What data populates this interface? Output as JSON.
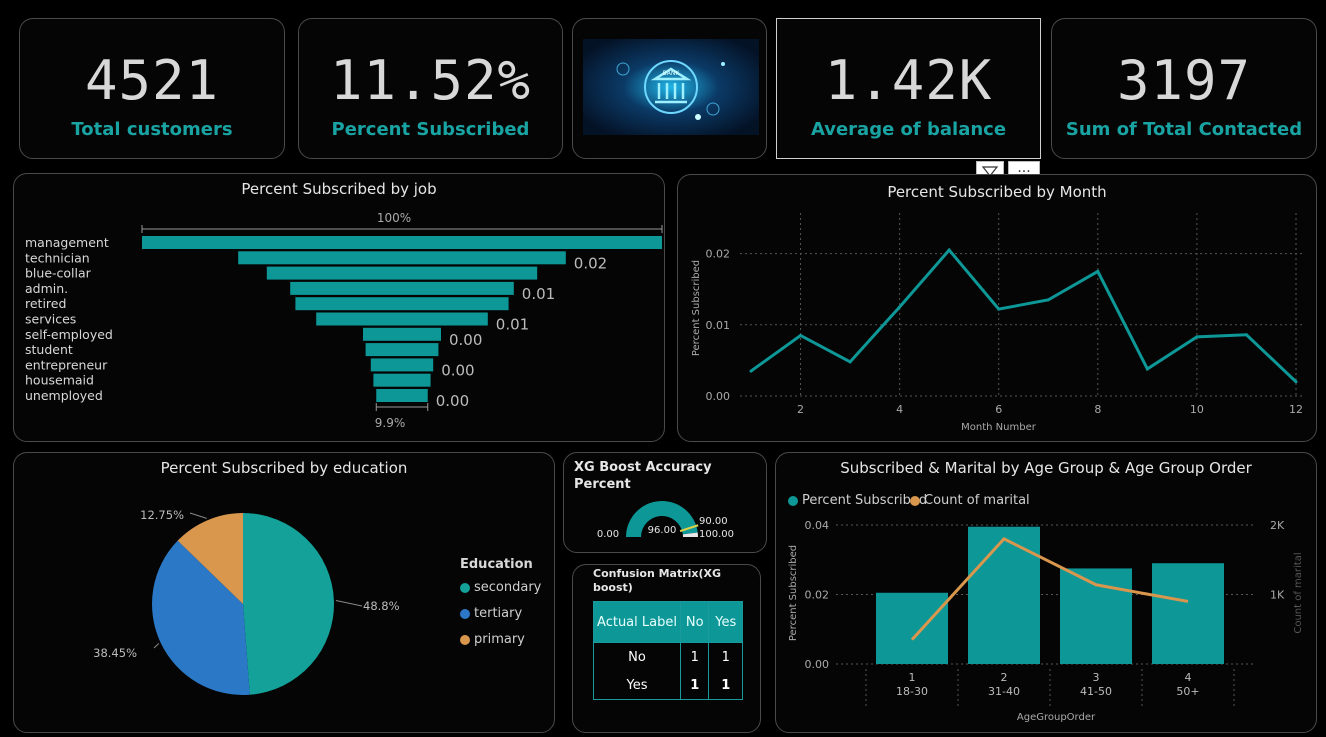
{
  "kpis": {
    "total_customers": {
      "value": "4521",
      "label": "Total customers"
    },
    "percent_subscribed": {
      "value": "11.52%",
      "label": "Percent Subscribed"
    },
    "avg_balance": {
      "value": "1.42K",
      "label": "Average of balance"
    },
    "total_contacted": {
      "value": "3197",
      "label": "Sum of Total Contacted"
    }
  },
  "bank_image": {
    "text": "BANK"
  },
  "toolbar": {
    "filter_icon": "filter-icon",
    "more_label": "···"
  },
  "colors": {
    "teal": "#0e9797",
    "orange": "#d9964d",
    "blue": "#2b78c6",
    "pie_teal": "#14a19a"
  },
  "chart_data": [
    {
      "type": "bar",
      "title": "Percent Subscribed by job",
      "categories": [
        "management",
        "technician",
        "blue-collar",
        "admin.",
        "retired",
        "services",
        "self-employed",
        "student",
        "entrepreneur",
        "housemaid",
        "unemployed"
      ],
      "values": [
        100,
        63,
        52,
        43,
        41,
        33,
        15,
        14,
        12,
        11,
        9.9
      ],
      "data_labels": [
        "",
        "0.02",
        "",
        "0.01",
        "",
        "0.01",
        "0.00",
        "",
        "0.00",
        "",
        "0.00"
      ],
      "top_label": "100%",
      "bottom_label": "9.9%"
    },
    {
      "type": "line",
      "title": "Percent Subscribed by Month",
      "xlabel": "Month Number",
      "ylabel": "Percent Subscribed",
      "x": [
        1,
        2,
        3,
        4,
        5,
        6,
        7,
        8,
        9,
        10,
        11,
        12
      ],
      "values": [
        0.0035,
        0.0085,
        0.0048,
        0.0125,
        0.0205,
        0.0122,
        0.0135,
        0.0175,
        0.0038,
        0.0083,
        0.0086,
        0.002
      ],
      "x_ticks": [
        "2",
        "4",
        "6",
        "8",
        "10",
        "12"
      ],
      "y_ticks": [
        "0.00",
        "0.01",
        "0.02"
      ],
      "ylim": [
        0,
        0.025
      ],
      "grid": true
    },
    {
      "type": "pie",
      "title": "Percent Subscribed by education",
      "legend_title": "Education",
      "slices": [
        {
          "name": "secondary",
          "value": 48.8,
          "label": "48.8%",
          "color": "#14a19a"
        },
        {
          "name": "tertiary",
          "value": 38.45,
          "label": "38.45%",
          "color": "#2b78c6"
        },
        {
          "name": "primary",
          "value": 12.75,
          "label": "12.75%",
          "color": "#d9964d"
        }
      ]
    },
    {
      "type": "bar",
      "title": "Subscribed & Marital by Age Group & Age Group Order",
      "xlabel": "AgeGroupOrder",
      "ylabel": "Percent Subscribed",
      "y2label": "Count of marital",
      "categories": [
        "1",
        "2",
        "3",
        "4"
      ],
      "sub_categories": [
        "18-30",
        "31-40",
        "41-50",
        "50+"
      ],
      "series": [
        {
          "name": "Percent Subscribed",
          "values": [
            0.0205,
            0.0395,
            0.0275,
            0.029
          ]
        },
        {
          "name": "Count of marital",
          "values": [
            350,
            1800,
            1140,
            900
          ]
        }
      ],
      "y_ticks": [
        "0.00",
        "0.02",
        "0.04"
      ],
      "y2_ticks": [
        "1K",
        "2K"
      ],
      "ylim": [
        0,
        0.04
      ],
      "y2lim": [
        0,
        2500
      ]
    }
  ],
  "gauge": {
    "title_line1": "XG Boost Accuracy",
    "title_line2": "Percent",
    "min_label": "0.00",
    "value_label": "96.00",
    "target_label": "90.00",
    "max_label": "100.00",
    "value": 96,
    "target": 90,
    "max": 100
  },
  "confusion": {
    "title_line1": "Confusion Matrix(XG",
    "title_line2": "boost)",
    "header": [
      "Actual Label",
      "No",
      "Yes"
    ],
    "rows": [
      [
        "No",
        "1",
        "1"
      ],
      [
        "Yes",
        "1",
        "1"
      ]
    ]
  }
}
